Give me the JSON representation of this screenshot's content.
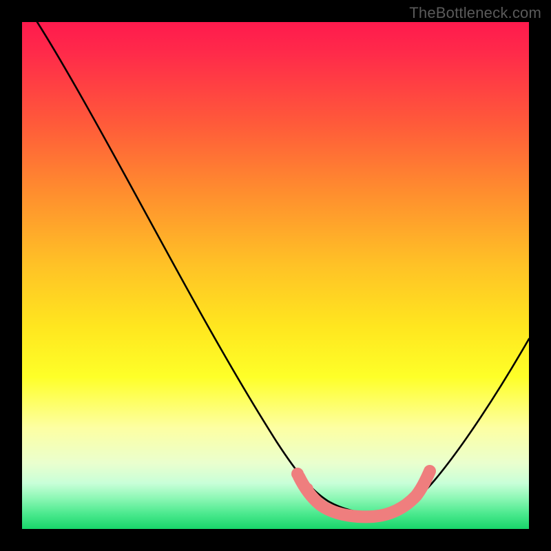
{
  "watermark": "TheBottleneck.com",
  "chart_data": {
    "type": "line",
    "title": "",
    "xlabel": "",
    "ylabel": "",
    "xlim": [
      0,
      100
    ],
    "ylim": [
      0,
      100
    ],
    "grid": false,
    "legend": false,
    "annotations": [],
    "gradient_stops": [
      {
        "pos": 0,
        "color": "#ff1a4d"
      },
      {
        "pos": 20,
        "color": "#ff5a3a"
      },
      {
        "pos": 48,
        "color": "#ffc226"
      },
      {
        "pos": 70,
        "color": "#feff28"
      },
      {
        "pos": 87,
        "color": "#eaffce"
      },
      {
        "pos": 100,
        "color": "#18d66a"
      }
    ],
    "series": [
      {
        "name": "bottleneck-curve",
        "color": "#000000",
        "x": [
          3,
          10,
          18,
          26,
          34,
          42,
          50,
          53,
          56,
          60,
          64,
          68,
          72,
          76,
          80,
          85,
          90,
          95,
          100
        ],
        "y": [
          100,
          88,
          76,
          63,
          50,
          37,
          24,
          16,
          10,
          5,
          2,
          1,
          1,
          2,
          6,
          14,
          24,
          35,
          46
        ]
      },
      {
        "name": "valley-highlight",
        "color": "#f27b7b",
        "x": [
          55,
          58,
          60,
          63,
          66,
          69,
          72,
          75,
          77
        ],
        "y": [
          10,
          6,
          4,
          2,
          1.5,
          1.5,
          2,
          4,
          7
        ]
      }
    ]
  }
}
